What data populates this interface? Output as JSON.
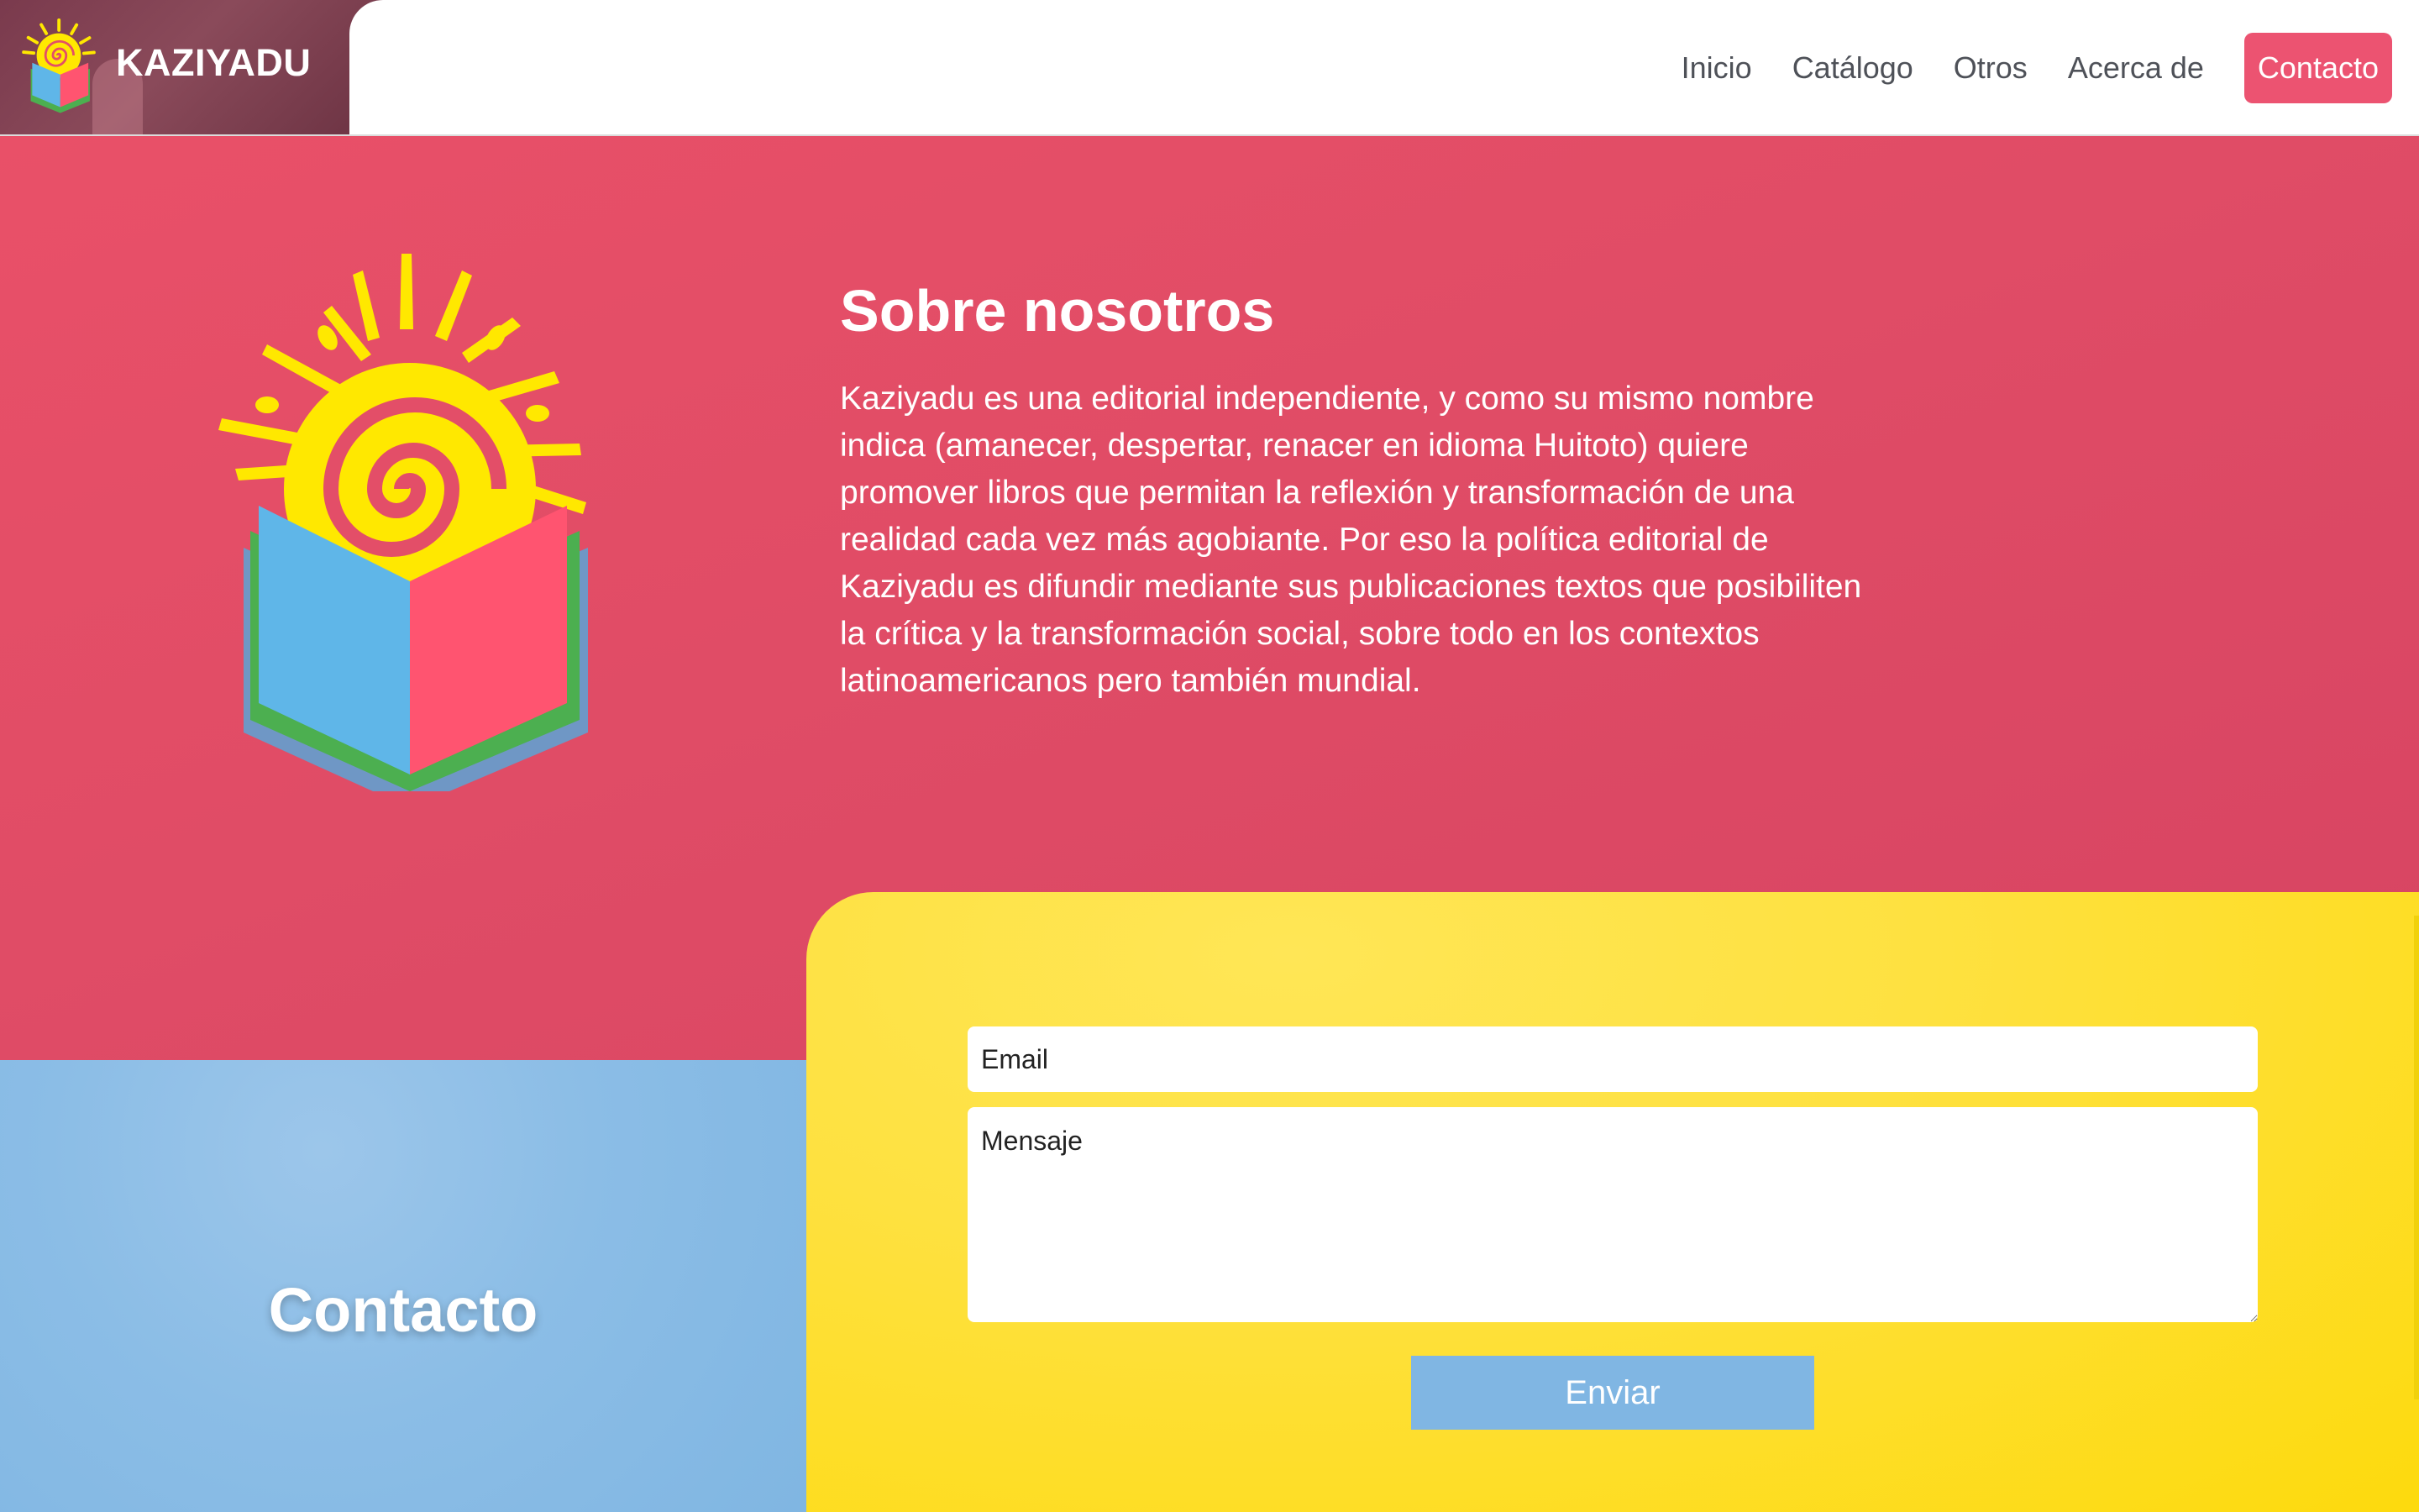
{
  "brand": {
    "name": "KAZIYADU"
  },
  "nav": {
    "links": [
      "Inicio",
      "Catálogo",
      "Otros",
      "Acerca de"
    ],
    "cta": "Contacto"
  },
  "about": {
    "title": "Sobre nosotros",
    "body": "Kaziyadu es una editorial independiente, y como su mismo nombre indica (amanecer, despertar, renacer en idioma Huitoto) quiere promover libros que permitan la reflexión y transformación de una realidad cada vez más agobiante. Por eso la política editorial de Kaziyadu es difundir mediante sus publicaciones textos que posibiliten la crítica y la transformación social, sobre todo en los contextos latinoamericanos pero también mundial."
  },
  "contact": {
    "title": "Contacto",
    "email_placeholder": "Email",
    "message_placeholder": "Mensaje",
    "send_label": "Enviar"
  },
  "colors": {
    "primary_red": "#e34e68",
    "nav_cta": "#ec5371",
    "contact_blue": "#85b9e4",
    "contact_yellow": "#fede2a",
    "logo_yellow": "#ffe800",
    "logo_book_blue": "#5fb6e8",
    "logo_book_red": "#ff5470",
    "logo_book_green": "#4caf50"
  },
  "icons": {
    "logo": "sun-spiral-book-icon"
  }
}
